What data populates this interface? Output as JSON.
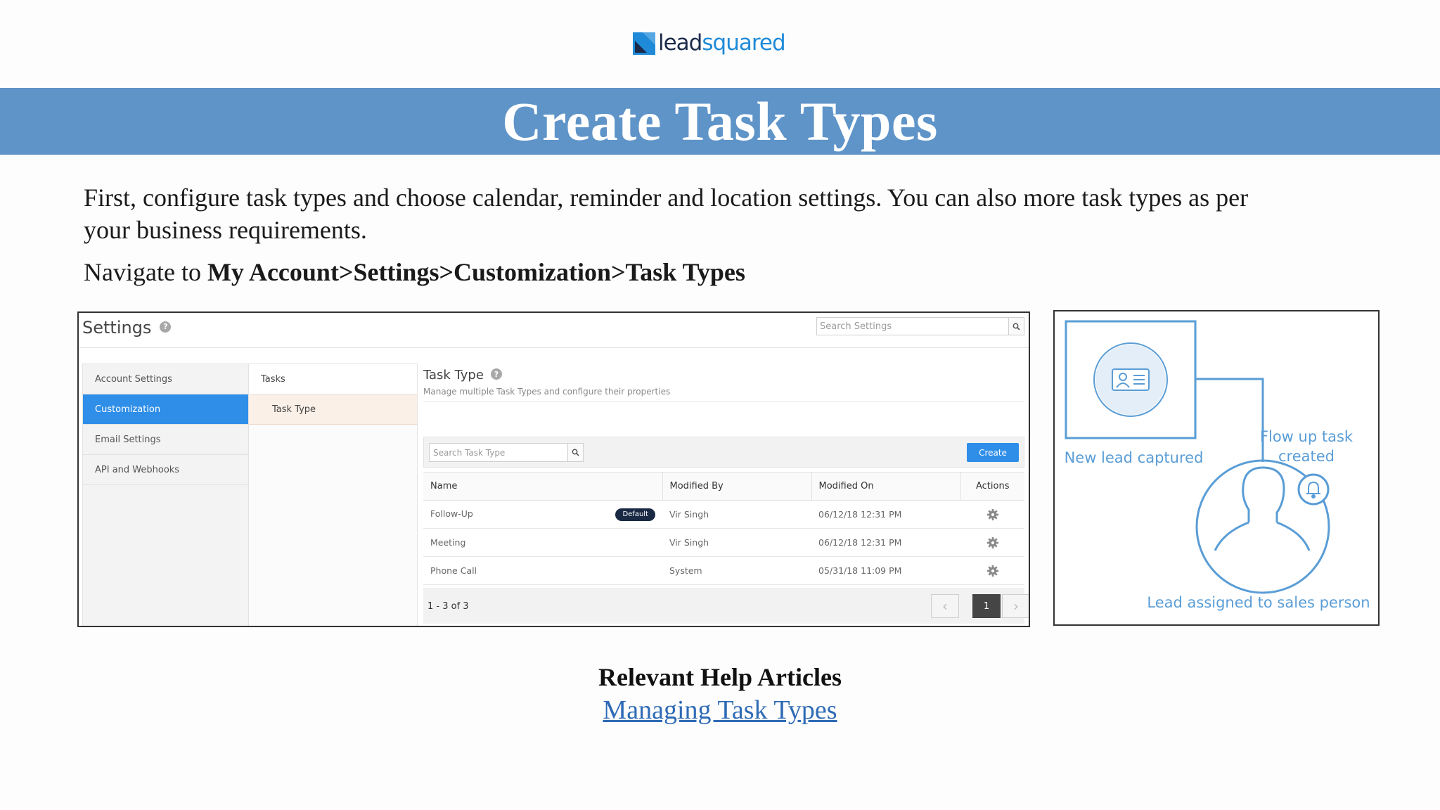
{
  "header": {
    "logo": {
      "part1": "lead",
      "part2": "squared",
      "brand_color": "#1f8ad8"
    },
    "title": "Create Task Types",
    "banner_color": "#5f94c8"
  },
  "intro": {
    "paragraph": "First, configure task types and choose calendar, reminder and location settings. You can also more task types as per your business requirements.",
    "nav_prefix": "Navigate to ",
    "nav_path": "My Account>Settings>Customization>Task Types"
  },
  "settings_ui": {
    "title": "Settings",
    "help_glyph": "?",
    "search_placeholder": "Search Settings",
    "menu": [
      {
        "label": "Account Settings"
      },
      {
        "label": "Customization"
      },
      {
        "label": "Email Settings"
      },
      {
        "label": "API and Webhooks"
      }
    ],
    "submenu": {
      "header": "Tasks",
      "item": "Task Type"
    },
    "panel": {
      "title": "Task Type",
      "subtitle": "Manage multiple Task Types and configure their properties",
      "search_placeholder": "Search Task Type",
      "create_label": "Create",
      "columns": [
        "Name",
        "Modified By",
        "Modified On",
        "Actions"
      ],
      "rows": [
        {
          "name": "Follow-Up",
          "badge": "Default",
          "modified_by": "Vir Singh",
          "modified_on": "06/12/18 12:31 PM"
        },
        {
          "name": "Meeting",
          "badge": "",
          "modified_by": "Vir Singh",
          "modified_on": "06/12/18 12:31 PM"
        },
        {
          "name": "Phone Call",
          "badge": "",
          "modified_by": "System",
          "modified_on": "05/31/18 11:09 PM"
        }
      ],
      "pager": {
        "summary": "1 - 3 of 3",
        "prev": "‹",
        "page": "1",
        "next": "›"
      }
    },
    "accent_color": "#2f8ee8"
  },
  "flow_diagram": {
    "new_lead": "New lead captured",
    "follow_up": "Flow up task created",
    "assigned": "Lead assigned to sales person",
    "color": "#5a9dd6"
  },
  "help": {
    "heading": "Relevant Help Articles",
    "link_text": "Managing Task Types"
  }
}
